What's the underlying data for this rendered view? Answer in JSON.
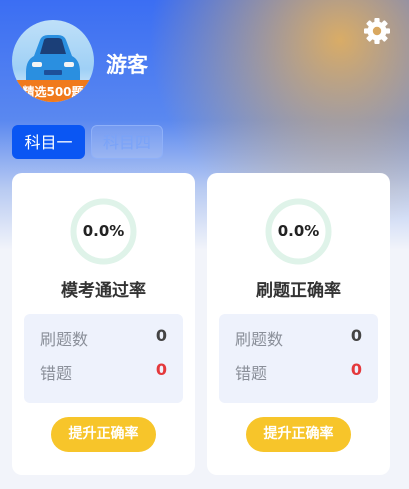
{
  "header": {
    "username": "游客",
    "avatar_badge": "精选500题",
    "settings_icon": "gear-icon"
  },
  "tabs": [
    {
      "label": "科目一",
      "active": true
    },
    {
      "label": "科目四",
      "active": false
    }
  ],
  "cards": [
    {
      "percent": "0.0%",
      "progress": 0,
      "title": "模考通过率",
      "stats": [
        {
          "label": "刷题数",
          "value": "0"
        },
        {
          "label": "错题",
          "value": "0"
        }
      ],
      "button_label": "提升正确率"
    },
    {
      "percent": "0.0%",
      "progress": 0,
      "title": "刷题正确率",
      "stats": [
        {
          "label": "刷题数",
          "value": "0"
        },
        {
          "label": "错题",
          "value": "0"
        }
      ],
      "button_label": "提升正确率"
    }
  ],
  "colors": {
    "primary": "#0a56f3",
    "accent_button": "#f7c52a",
    "ring": "#dff3e9",
    "error_value": "#e4393c"
  }
}
